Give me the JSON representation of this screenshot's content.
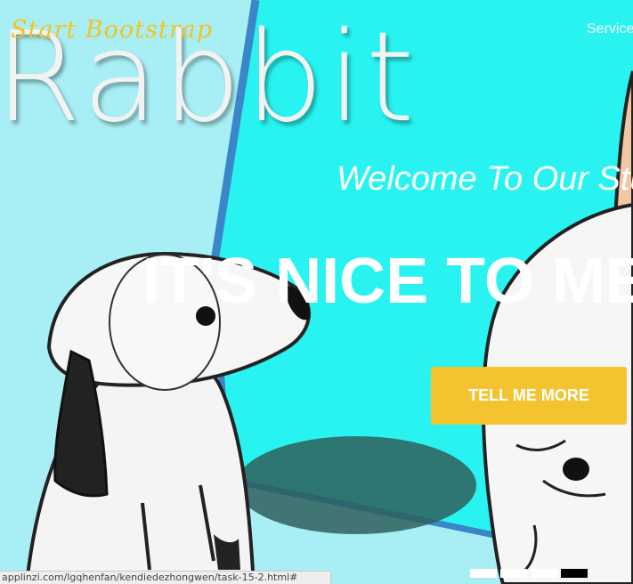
{
  "navbar": {
    "brand": "Start Bootstrap",
    "items": [
      {
        "label": "Services"
      }
    ]
  },
  "hero": {
    "background_word": "Rabbit",
    "subheading": "Welcome To Our Studio!",
    "heading": "IT'S NICE TO MEET YOU",
    "cta_label": "TELL ME MORE"
  },
  "carousel": {
    "slides": 4,
    "active_index": 3
  },
  "status_bar": {
    "url": "applinzi.com/lgqhenfan/kendiedezhongwen/task-15-2.html#"
  },
  "colors": {
    "accent": "#f4c430",
    "panel": "#28f3f0",
    "background": "#a7eff5",
    "text": "#ffffff"
  }
}
